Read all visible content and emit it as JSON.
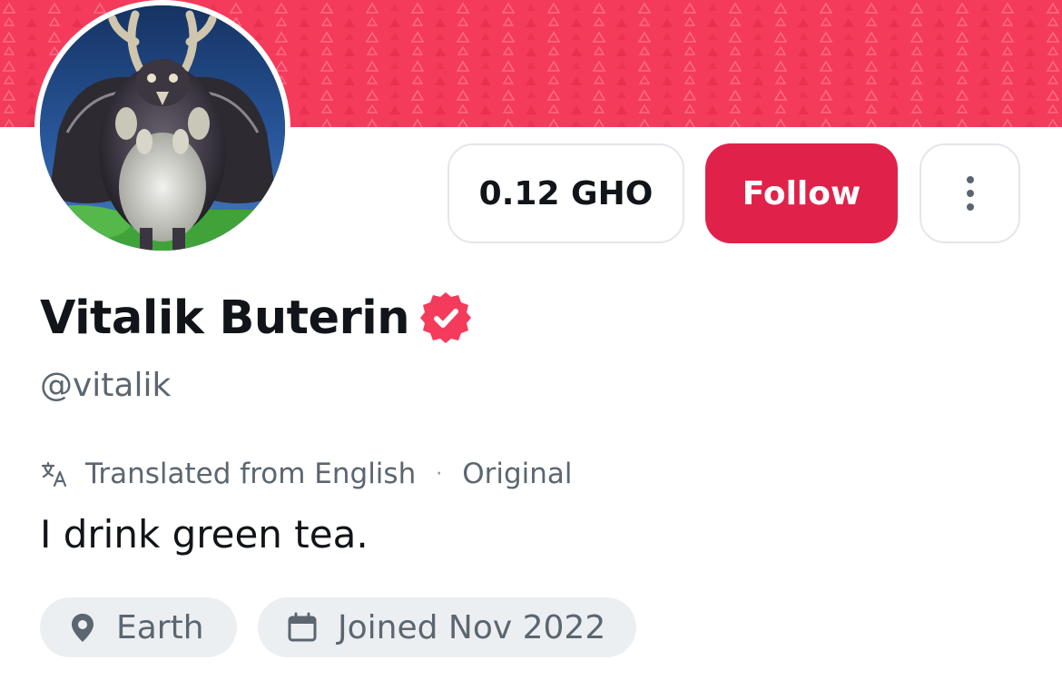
{
  "profile": {
    "name": "Vitalik Buterin",
    "handle": "@vitalik",
    "bio": "I drink green tea.",
    "verified": true
  },
  "actions": {
    "tip_label": "0.12 GHO",
    "follow_label": "Follow",
    "more_icon": "more-vertical-icon"
  },
  "translation": {
    "label": "Translated from English",
    "separator": "·",
    "original_label": "Original"
  },
  "meta": {
    "location": "Earth",
    "joined": "Joined Nov 2022"
  },
  "colors": {
    "banner": "#f43b5b",
    "accent": "#e0224a",
    "badge": "#f43b5b",
    "muted_text": "#5b6670",
    "pill_bg": "#eceff2"
  },
  "icons": {
    "translate": "translate-icon",
    "location": "map-pin-icon",
    "calendar": "calendar-icon",
    "verified": "verified-badge-icon"
  }
}
